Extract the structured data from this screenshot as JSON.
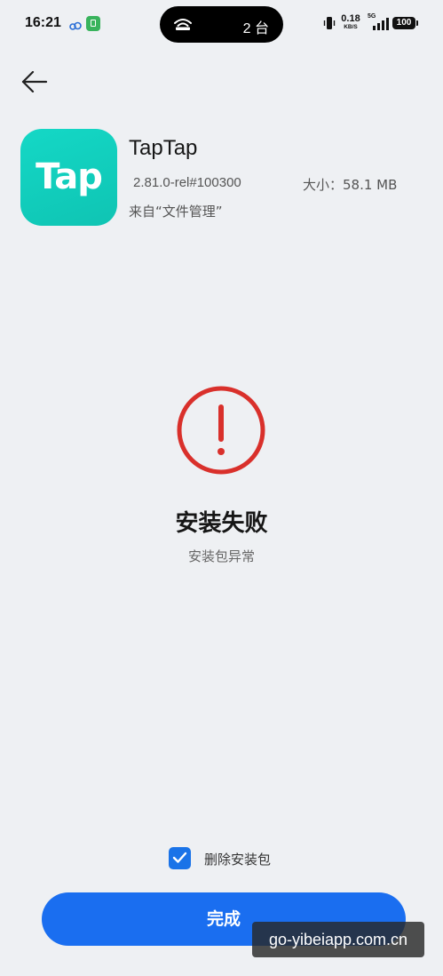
{
  "status_bar": {
    "time": "16:21",
    "island_text": "2 台",
    "net_speed": "0.18",
    "net_speed_unit": "KB/S",
    "net_type": "5G",
    "battery": "100"
  },
  "app": {
    "name": "TapTap",
    "icon_text": "Tap",
    "version": "2.81.0-rel#100300",
    "size": "大小：58.1 MB",
    "source": "来自“文件管理”"
  },
  "result": {
    "title": "安装失败",
    "reason": "安装包异常"
  },
  "options": {
    "delete_package_label": "删除安装包",
    "delete_package_checked": true
  },
  "actions": {
    "done_label": "完成"
  },
  "watermark": "go-yibeiapp.com.cn",
  "colors": {
    "background": "#eef0f3",
    "primary_button": "#1a6ef0",
    "checkbox": "#1a73e8",
    "error_red": "#d9302b",
    "app_icon": "#14d8c6"
  },
  "icons": {
    "back": "arrow-left-icon",
    "error": "exclamation-circle-icon",
    "checkbox": "check-icon"
  }
}
